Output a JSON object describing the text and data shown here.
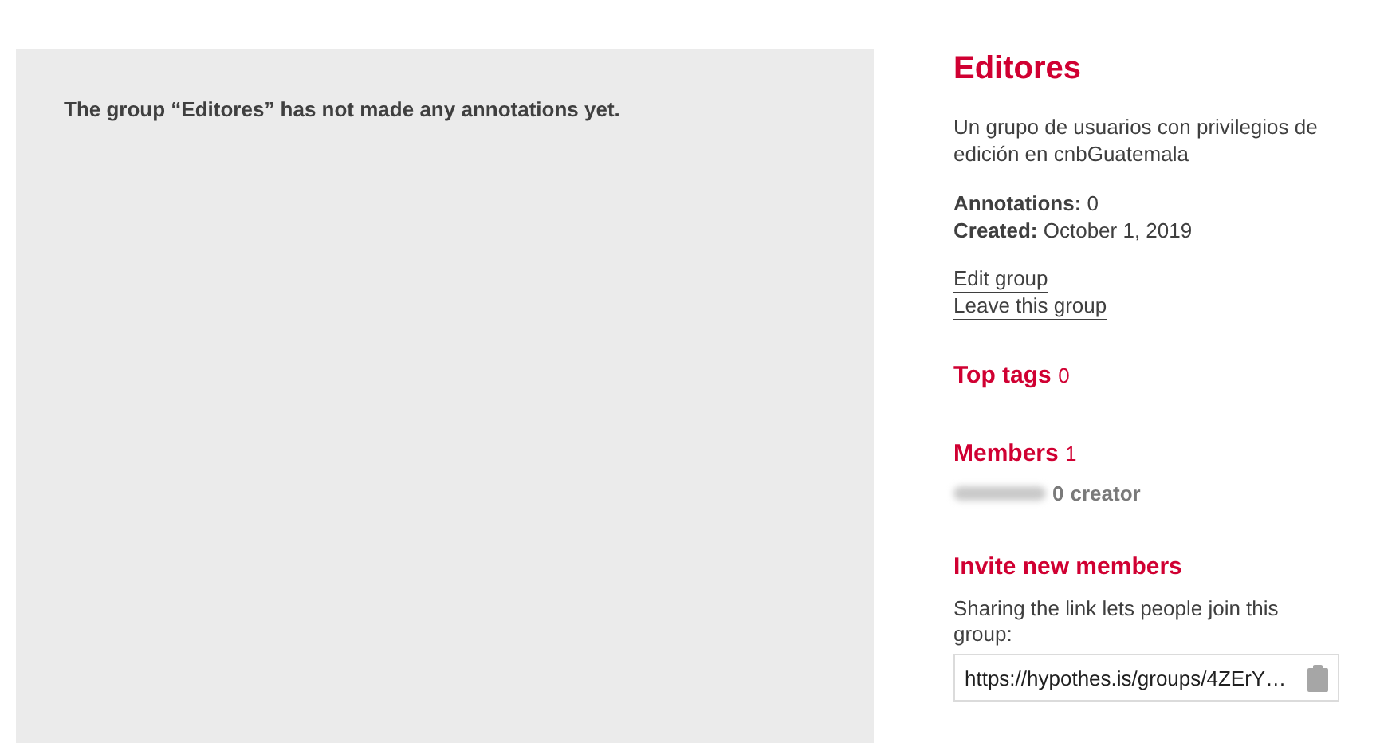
{
  "main": {
    "message": "The group “Editores” has not made any annotations yet."
  },
  "sidebar": {
    "title": "Editores",
    "description": "Un grupo de usuarios con privilegios de edición en cnbGuatemala",
    "stats": [
      {
        "label": "Annotations:",
        "value": "0"
      },
      {
        "label": "Created:",
        "value": "October 1, 2019"
      }
    ],
    "links": [
      "Edit group",
      "Leave this group"
    ],
    "top_tags": {
      "title": "Top tags",
      "count": "0"
    },
    "members": {
      "title": "Members",
      "count": "1",
      "list": [
        {
          "count": "0",
          "role": "creator"
        }
      ]
    },
    "invite": {
      "title": "Invite new members",
      "text": "Sharing the link lets people join this group:",
      "link": "https://hypothes.is/groups/4ZErY…"
    }
  }
}
